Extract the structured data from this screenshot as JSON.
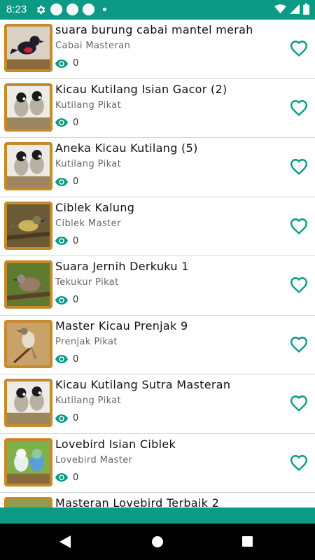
{
  "status_bar": {
    "time": "8:23",
    "icons": [
      "gear-icon",
      "circle-icon",
      "circle-icon",
      "circle-icon",
      "dot-icon",
      "wifi-icon",
      "signal-icon",
      "battery-icon"
    ]
  },
  "items": [
    {
      "title": "suara burung cabai mantel merah",
      "subtitle": "Cabai Masteran",
      "views": "0"
    },
    {
      "title": "Kicau Kutilang Isian Gacor (2)",
      "subtitle": "Kutilang Pikat",
      "views": "0"
    },
    {
      "title": "Aneka Kicau Kutilang (5)",
      "subtitle": "Kutilang Pikat",
      "views": "0"
    },
    {
      "title": "Ciblek Kalung",
      "subtitle": "Ciblek Master",
      "views": "0"
    },
    {
      "title": "Suara Jernih Derkuku 1",
      "subtitle": "Tekukur Pikat",
      "views": "0"
    },
    {
      "title": "Master Kicau Prenjak 9",
      "subtitle": "Prenjak Pikat",
      "views": "0"
    },
    {
      "title": "Kicau Kutilang Sutra Masteran",
      "subtitle": "Kutilang Pikat",
      "views": "0"
    },
    {
      "title": "Lovebird Isian Ciblek",
      "subtitle": "Lovebird Master",
      "views": "0"
    },
    {
      "title": "Masteran Lovebird Terbaik 2",
      "subtitle": "",
      "views": ""
    }
  ],
  "colors": {
    "accent": "#0a9a86",
    "heart": "#0a9a86",
    "eye": "#0a9a86",
    "thumb_frame": "#c58a2a"
  }
}
